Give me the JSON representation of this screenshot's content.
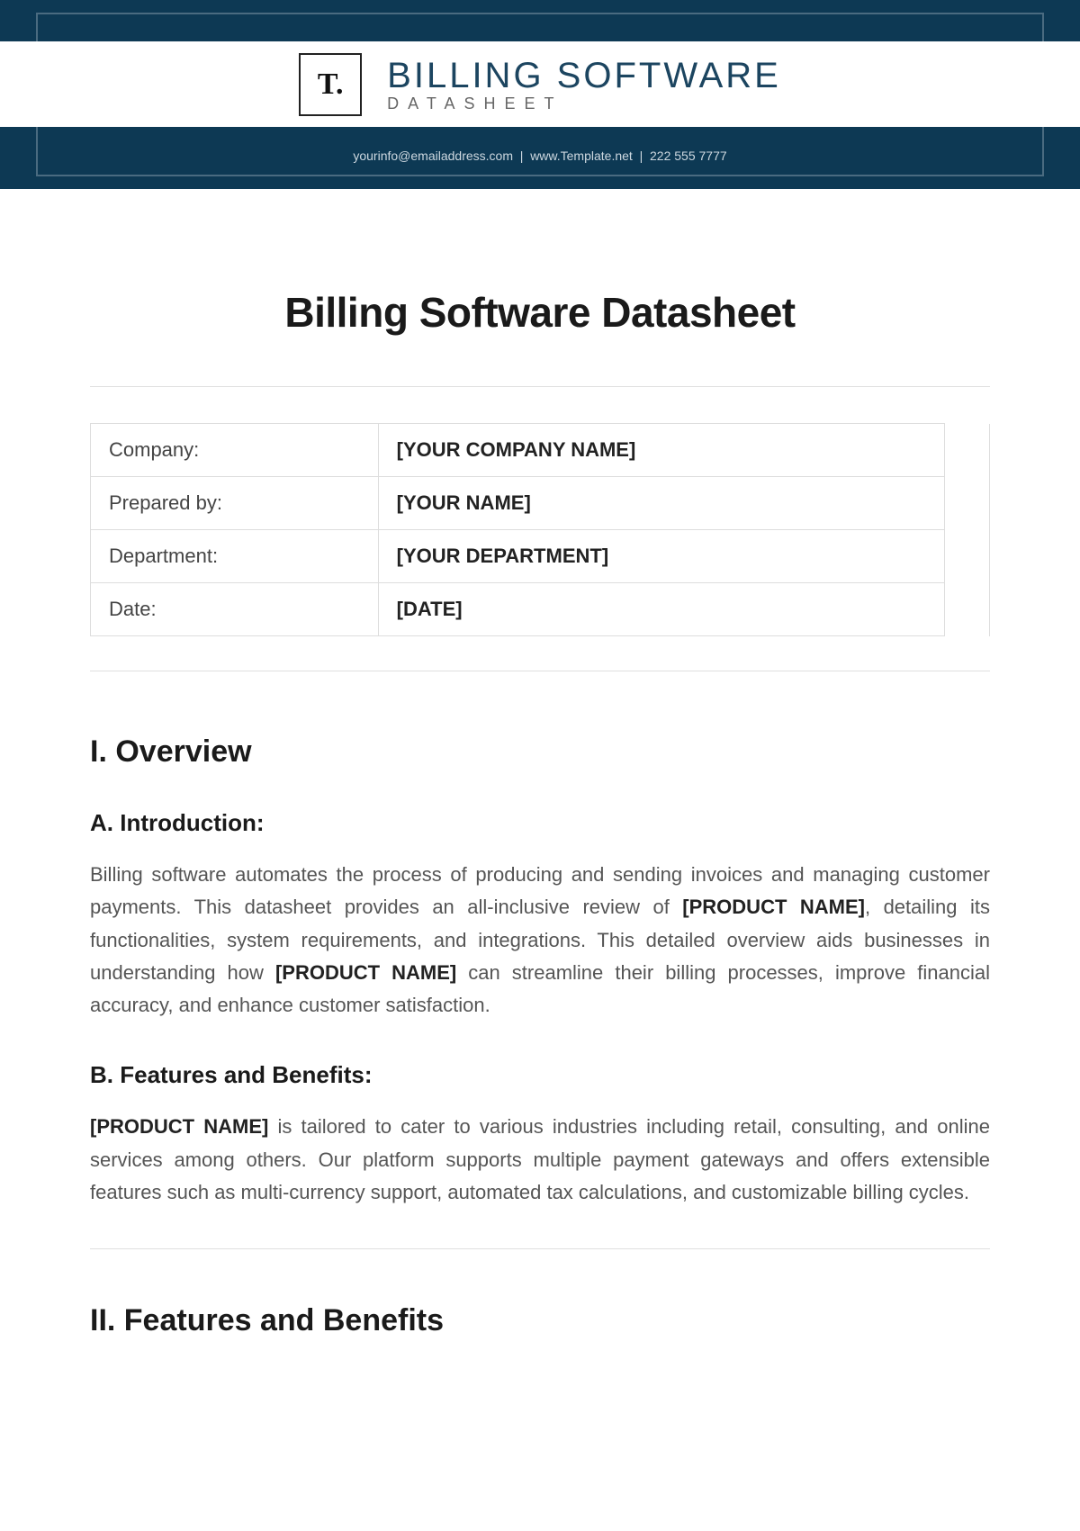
{
  "header": {
    "logo_text": "T.",
    "brand_title": "BILLING SOFTWARE",
    "brand_sub": "DATASHEET",
    "contact_email": "yourinfo@emailaddress.com",
    "contact_site": "www.Template.net",
    "contact_phone": "222 555 7777"
  },
  "doc": {
    "title": "Billing Software Datasheet"
  },
  "info": {
    "rows": [
      {
        "label": "Company:",
        "value": "[YOUR COMPANY NAME]"
      },
      {
        "label": "Prepared by:",
        "value": "[YOUR NAME]"
      },
      {
        "label": "Department:",
        "value": "[YOUR DEPARTMENT]"
      },
      {
        "label": "Date:",
        "value": "[DATE]"
      }
    ]
  },
  "sections": {
    "overview_heading": "I. Overview",
    "intro_heading": "A. Introduction:",
    "intro_p1a": "Billing software automates the process of producing and sending invoices and managing customer payments. This datasheet provides an all-inclusive review of ",
    "intro_p1_bold1": "[PRODUCT NAME]",
    "intro_p1b": ", detailing its functionalities, system requirements, and integrations. This detailed overview aids businesses in understanding how ",
    "intro_p1_bold2": "[PRODUCT NAME]",
    "intro_p1c": " can streamline their billing processes, improve financial accuracy, and enhance customer satisfaction.",
    "features_heading": "B. Features and Benefits:",
    "features_p_bold": "[PRODUCT NAME]",
    "features_p_rest": " is tailored to cater to various industries including retail, consulting, and online services among others. Our platform supports multiple payment gateways and offers extensible features such as multi-currency support, automated tax calculations, and customizable billing cycles.",
    "section2_heading": "II. Features and Benefits"
  }
}
